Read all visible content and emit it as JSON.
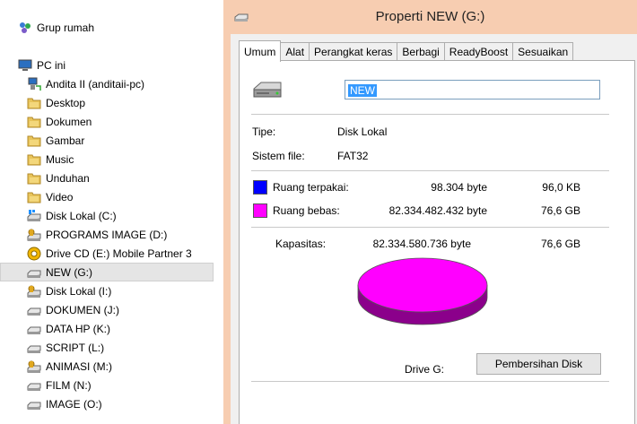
{
  "nav": {
    "homegroup": "Grup rumah",
    "this_pc": "PC ini",
    "items": [
      {
        "label": "Andita II (anditaii-pc)",
        "icon": "network-pc-icon"
      },
      {
        "label": "Desktop",
        "icon": "folder-icon"
      },
      {
        "label": "Dokumen",
        "icon": "folder-icon"
      },
      {
        "label": "Gambar",
        "icon": "folder-icon"
      },
      {
        "label": "Music",
        "icon": "folder-icon"
      },
      {
        "label": "Unduhan",
        "icon": "folder-icon"
      },
      {
        "label": "Video",
        "icon": "folder-icon"
      },
      {
        "label": "Disk Lokal (C:)",
        "icon": "windows-drive-icon"
      },
      {
        "label": "PROGRAMS IMAGE (D:)",
        "icon": "shared-drive-icon"
      },
      {
        "label": "Drive CD (E:)  Mobile Partner 3",
        "icon": "cd-drive-icon"
      },
      {
        "label": "NEW (G:)",
        "icon": "removable-drive-icon",
        "selected": true
      },
      {
        "label": "Disk Lokal (I:)",
        "icon": "shared-drive-icon"
      },
      {
        "label": "DOKUMEN (J:)",
        "icon": "drive-icon"
      },
      {
        "label": "DATA HP (K:)",
        "icon": "drive-icon"
      },
      {
        "label": "SCRIPT (L:)",
        "icon": "drive-icon"
      },
      {
        "label": "ANIMASI (M:)",
        "icon": "shared-drive-icon"
      },
      {
        "label": "FILM (N:)",
        "icon": "drive-icon"
      },
      {
        "label": "IMAGE (O:)",
        "icon": "drive-icon"
      }
    ]
  },
  "dialog": {
    "title": "Properti NEW (G:)",
    "tabs": [
      "Umum",
      "Alat",
      "Perangkat keras",
      "Berbagi",
      "ReadyBoost",
      "Sesuaikan"
    ],
    "active_tab": "Umum",
    "name_value": "NEW",
    "type_label": "Tipe:",
    "type_value": "Disk Lokal",
    "fs_label": "Sistem file:",
    "fs_value": "FAT32",
    "used_label": "Ruang terpakai:",
    "used_bytes": "98.304 byte",
    "used_size": "96,0 KB",
    "free_label": "Ruang bebas:",
    "free_bytes": "82.334.482.432 byte",
    "free_size": "76,6 GB",
    "capacity_label": "Kapasitas:",
    "capacity_bytes": "82.334.580.736 byte",
    "capacity_size": "76,6 GB",
    "drive_label": "Drive G:",
    "cleanup_button": "Pembersihan Disk",
    "used_fraction": 1.2e-06
  },
  "colors": {
    "used": "#0000ff",
    "free": "#ff00ff",
    "title_bar": "#f7cdb1",
    "selection": "#3399ff"
  }
}
